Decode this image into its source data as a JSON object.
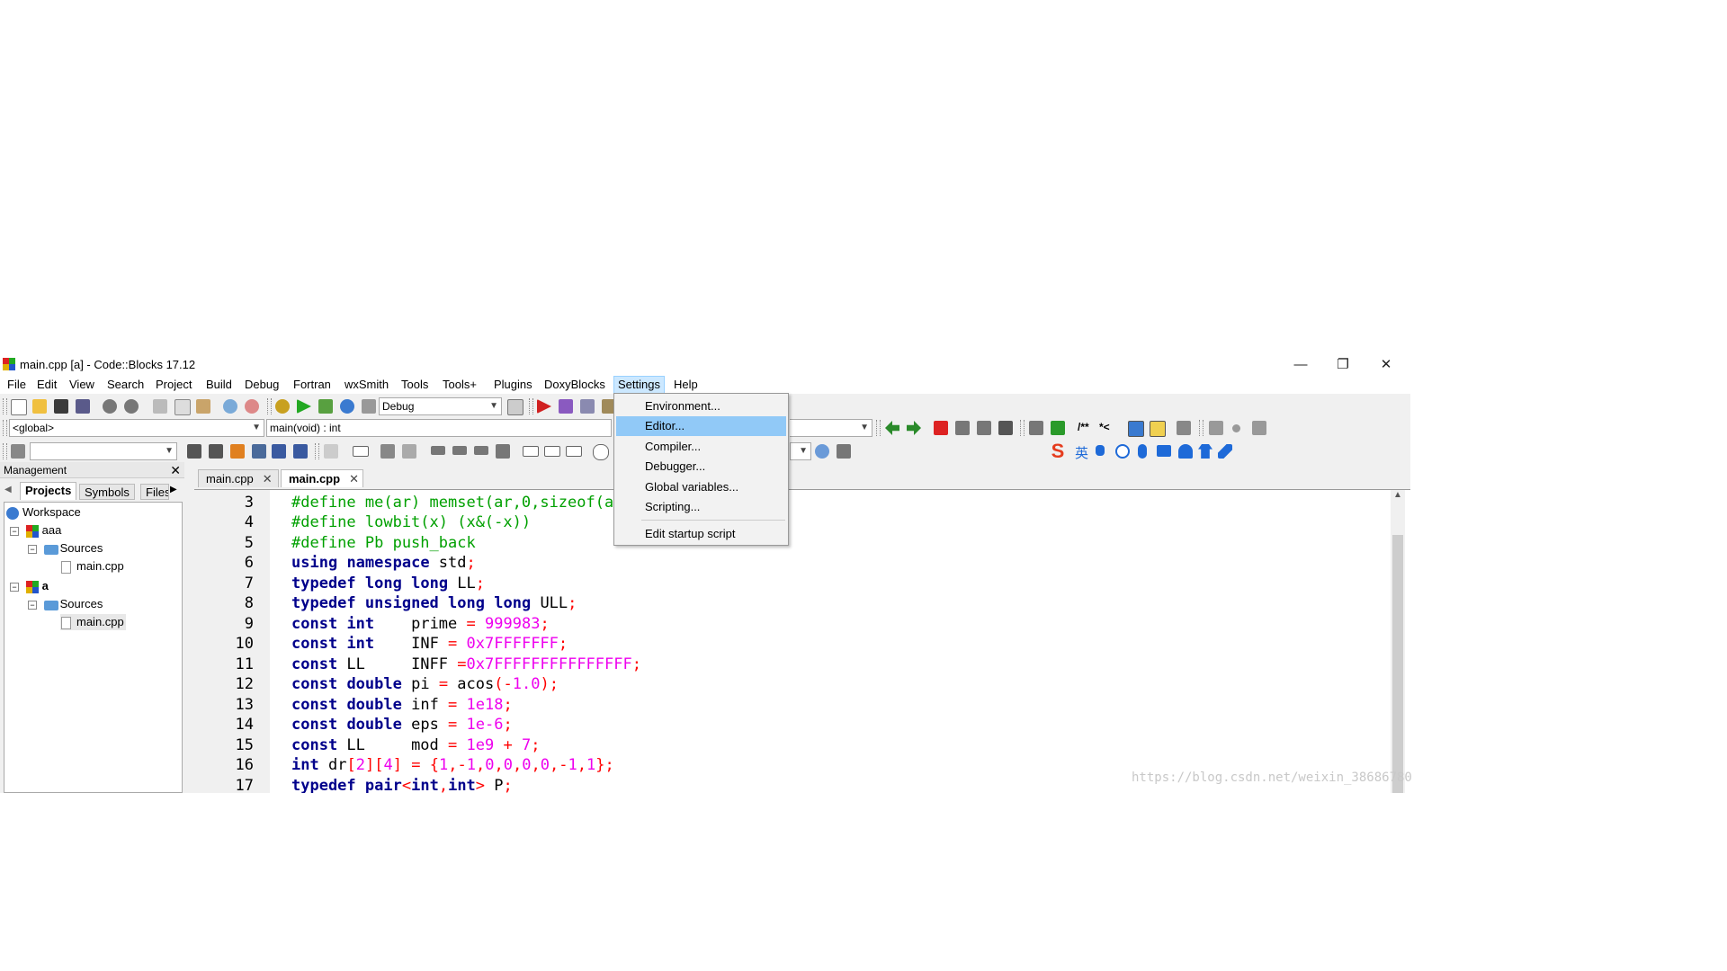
{
  "window": {
    "title": "main.cpp [a] - Code::Blocks 17.12",
    "minimize_glyph": "—",
    "maximize_glyph": "❐",
    "close_glyph": "✕"
  },
  "menubar": {
    "items": [
      "File",
      "Edit",
      "View",
      "Search",
      "Project",
      "Build",
      "Debug",
      "Fortran",
      "wxSmith",
      "Tools",
      "Tools+",
      "Plugins",
      "DoxyBlocks",
      "Settings",
      "Help"
    ],
    "active": "Settings"
  },
  "toolbar": {
    "build_target": "Debug",
    "scope_combo": "<global>",
    "function_combo": "main(void) : int",
    "doxy_comment_1": "/**",
    "doxy_comment_2": "*<"
  },
  "settings_menu": {
    "items": [
      "Environment...",
      "Editor...",
      "Compiler...",
      "Debugger...",
      "Global variables...",
      "Scripting..."
    ],
    "highlighted": "Editor...",
    "extra_item": "Edit startup script"
  },
  "management": {
    "title": "Management",
    "tabs": [
      "Projects",
      "Symbols",
      "Files"
    ],
    "selected_tab": "Projects",
    "tree": {
      "workspace": "Workspace",
      "projects": [
        {
          "name": "aaa",
          "folder": "Sources",
          "file": "main.cpp"
        },
        {
          "name": "a",
          "folder": "Sources",
          "file": "main.cpp"
        }
      ]
    }
  },
  "editor": {
    "tabs": [
      "main.cpp",
      "main.cpp"
    ],
    "selected_tab_index": 1,
    "line_numbers": [
      "3",
      "4",
      "5",
      "6",
      "7",
      "8",
      "9",
      "10",
      "11",
      "12",
      "13",
      "14",
      "15",
      "16",
      "17"
    ],
    "code_lines": [
      "#define me(ar) memset(ar,0,sizeof(a",
      "#define lowbit(x) (x&(-x))",
      "#define Pb push_back",
      "using namespace std;",
      "typedef long long LL;",
      "typedef unsigned long long ULL;",
      "const int    prime = 999983;",
      "const int    INF = 0x7FFFFFFF;",
      "const LL     INFF =0x7FFFFFFFFFFFFFFF;",
      "const double pi = acos(-1.0);",
      "const double inf = 1e18;",
      "const double eps = 1e-6;",
      "const LL     mod = 1e9 + 7;",
      "int dr[2][4] = {1,-1,0,0,0,0,-1,1};",
      "typedef pair<int,int> P;"
    ]
  },
  "ime_toolbar": {
    "logo": "S",
    "lang": "英"
  },
  "watermark": "https://blog.csdn.net/weixin_38686780",
  "colors": {
    "keyword": "#00008b",
    "preprocessor": "#00a000",
    "number": "#ee00ee",
    "operator": "#ff0000",
    "menu_highlight": "#91c9f7",
    "active_menu": "#cce8ff"
  }
}
